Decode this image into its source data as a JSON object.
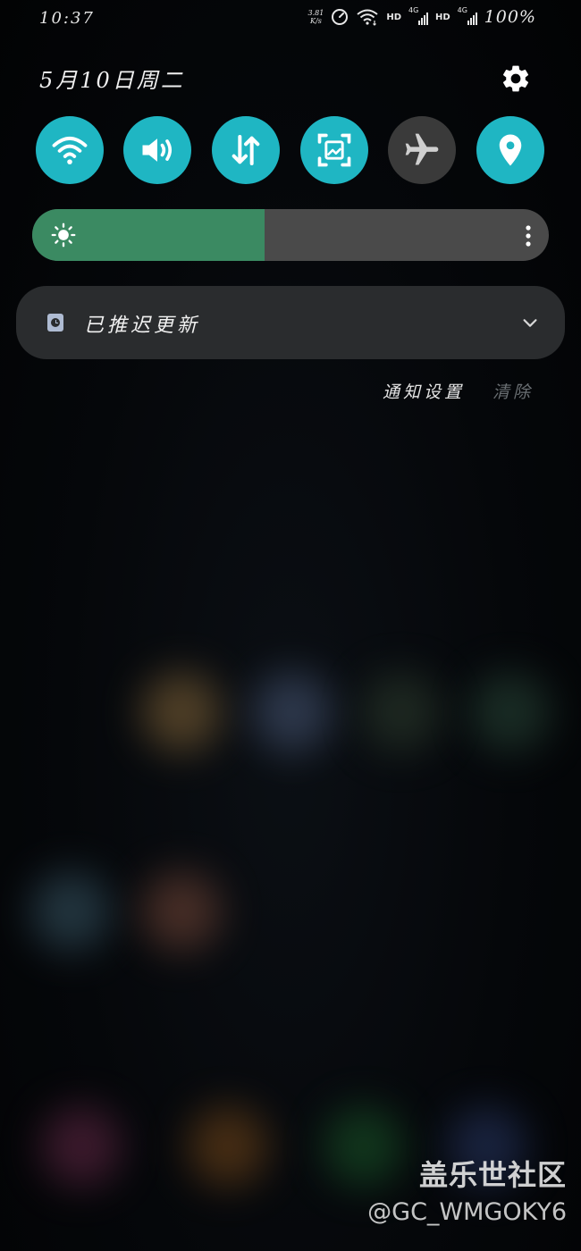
{
  "status_bar": {
    "time": "10:37",
    "net_speed_value": "3.81",
    "net_speed_unit": "K/s",
    "hd_1": "HD",
    "network_1": "4G",
    "hd_2": "HD",
    "network_2": "4G",
    "battery": "100%"
  },
  "header": {
    "date": "5月10日周二",
    "settings_icon": "gear-icon"
  },
  "quick_toggles": [
    {
      "icon": "wifi-icon",
      "state": "on"
    },
    {
      "icon": "sound-icon",
      "state": "on"
    },
    {
      "icon": "mobile-data-icon",
      "state": "on"
    },
    {
      "icon": "screenshot-icon",
      "state": "on"
    },
    {
      "icon": "airplane-icon",
      "state": "off"
    },
    {
      "icon": "location-icon",
      "state": "on"
    }
  ],
  "brightness": {
    "level": 0.45,
    "icon": "brightness-icon",
    "more_icon": "more-vertical-icon"
  },
  "notification": {
    "title": "已推迟更新",
    "icon": "scheduled-update-icon"
  },
  "actions": {
    "settings_label": "通知设置",
    "clear_label": "清除"
  },
  "watermark": {
    "title": "盖乐世社区",
    "handle": "@GC_WMGOKY6"
  },
  "colors": {
    "toggle_on": "#1fb6c3",
    "toggle_off": "#3a3a3a",
    "brightness_fill": "#3b8a62",
    "brightness_track": "#4a4a4a",
    "card_bg": "#2a2c2e"
  }
}
